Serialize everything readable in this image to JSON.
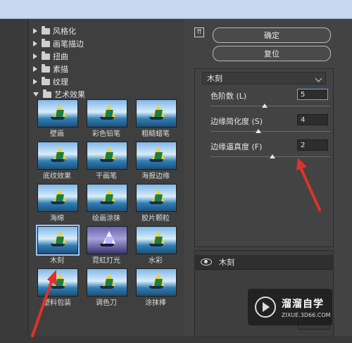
{
  "filter_categories": [
    {
      "label": "风格化"
    },
    {
      "label": "画笔描边"
    },
    {
      "label": "扭曲"
    },
    {
      "label": "素描"
    },
    {
      "label": "纹理"
    },
    {
      "label": "艺术效果"
    }
  ],
  "thumbnails": [
    {
      "label": "壁画"
    },
    {
      "label": "彩色铅笔"
    },
    {
      "label": "粗糙蜡笔"
    },
    {
      "label": "底纹效果"
    },
    {
      "label": "干画笔"
    },
    {
      "label": "海报边缘"
    },
    {
      "label": "海绵"
    },
    {
      "label": "绘画涂抹"
    },
    {
      "label": "胶片颗粒"
    },
    {
      "label": "木刻"
    },
    {
      "label": "霓虹灯光"
    },
    {
      "label": "水彩"
    },
    {
      "label": "塑料包装"
    },
    {
      "label": "调色刀"
    },
    {
      "label": "涂抹棒"
    }
  ],
  "buttons": {
    "ok": "确定",
    "reset": "复位"
  },
  "settings": {
    "filter_name": "木刻",
    "params": [
      {
        "label": "色阶数 (L)",
        "value": "5",
        "slider": 0.45
      },
      {
        "label": "边缘简化度 (S)",
        "value": "4",
        "slider": 0.4
      },
      {
        "label": "边缘逼真度 (F)",
        "value": "2",
        "slider": 0.52
      }
    ]
  },
  "layers": {
    "name": "木刻"
  },
  "watermark": {
    "title": "溜溜自学",
    "url": "ZIXUE.3D66.COM"
  },
  "colors": {
    "accent": "#6aa2ff",
    "annotation_red": "#e0312b"
  }
}
